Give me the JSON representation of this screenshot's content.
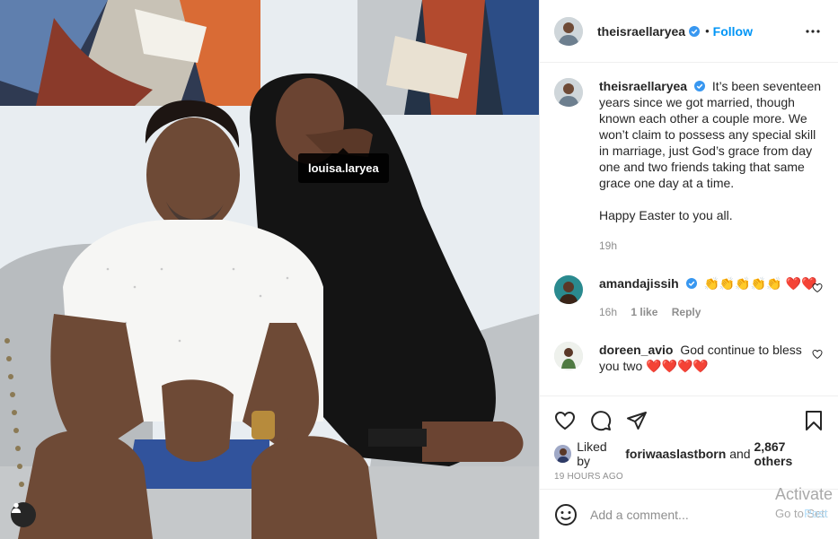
{
  "photo": {
    "tag_username": "louisa.laryea"
  },
  "post": {
    "author": "theisraellaryea",
    "follow_label": "Follow",
    "dot": "•",
    "caption_text": "It’s been seventeen years since we got married, though known each other a couple more. We won’t claim to possess any special skill in marriage, just God’s grace from day one and two friends taking that same grace one day at a time.",
    "caption_text_2": "Happy Easter to you all.",
    "caption_time": "19h",
    "comments": [
      {
        "username": "amandajissih",
        "text": "👏👏👏👏👏 ❤️❤️",
        "time": "16h",
        "likes": "1 like",
        "reply": "Reply"
      },
      {
        "username": "doreen_avio",
        "text": "God continue to bless you two ❤️❤️❤️❤️"
      }
    ],
    "liked_by_prefix": "Liked by",
    "liked_by_user": "foriwaaslastborn",
    "liked_by_and": "and",
    "liked_by_others": "2,867 others",
    "date": "19 HOURS AGO",
    "add_comment_placeholder": "Add a comment...",
    "post_button": "Post"
  },
  "watermark": {
    "line1": "Activate",
    "line2": "Go to Sett"
  },
  "icons": {
    "verified": "verified-badge-icon",
    "more": "more-options-icon",
    "like": "heart-icon",
    "comment": "comment-bubble-icon",
    "share": "paper-plane-icon",
    "save": "bookmark-icon",
    "emoji": "emoji-smiley-icon",
    "user_tag": "user-tag-icon"
  },
  "colors": {
    "accent": "#0095f6",
    "verified": "#3897f0",
    "heart": "#ed4956"
  }
}
